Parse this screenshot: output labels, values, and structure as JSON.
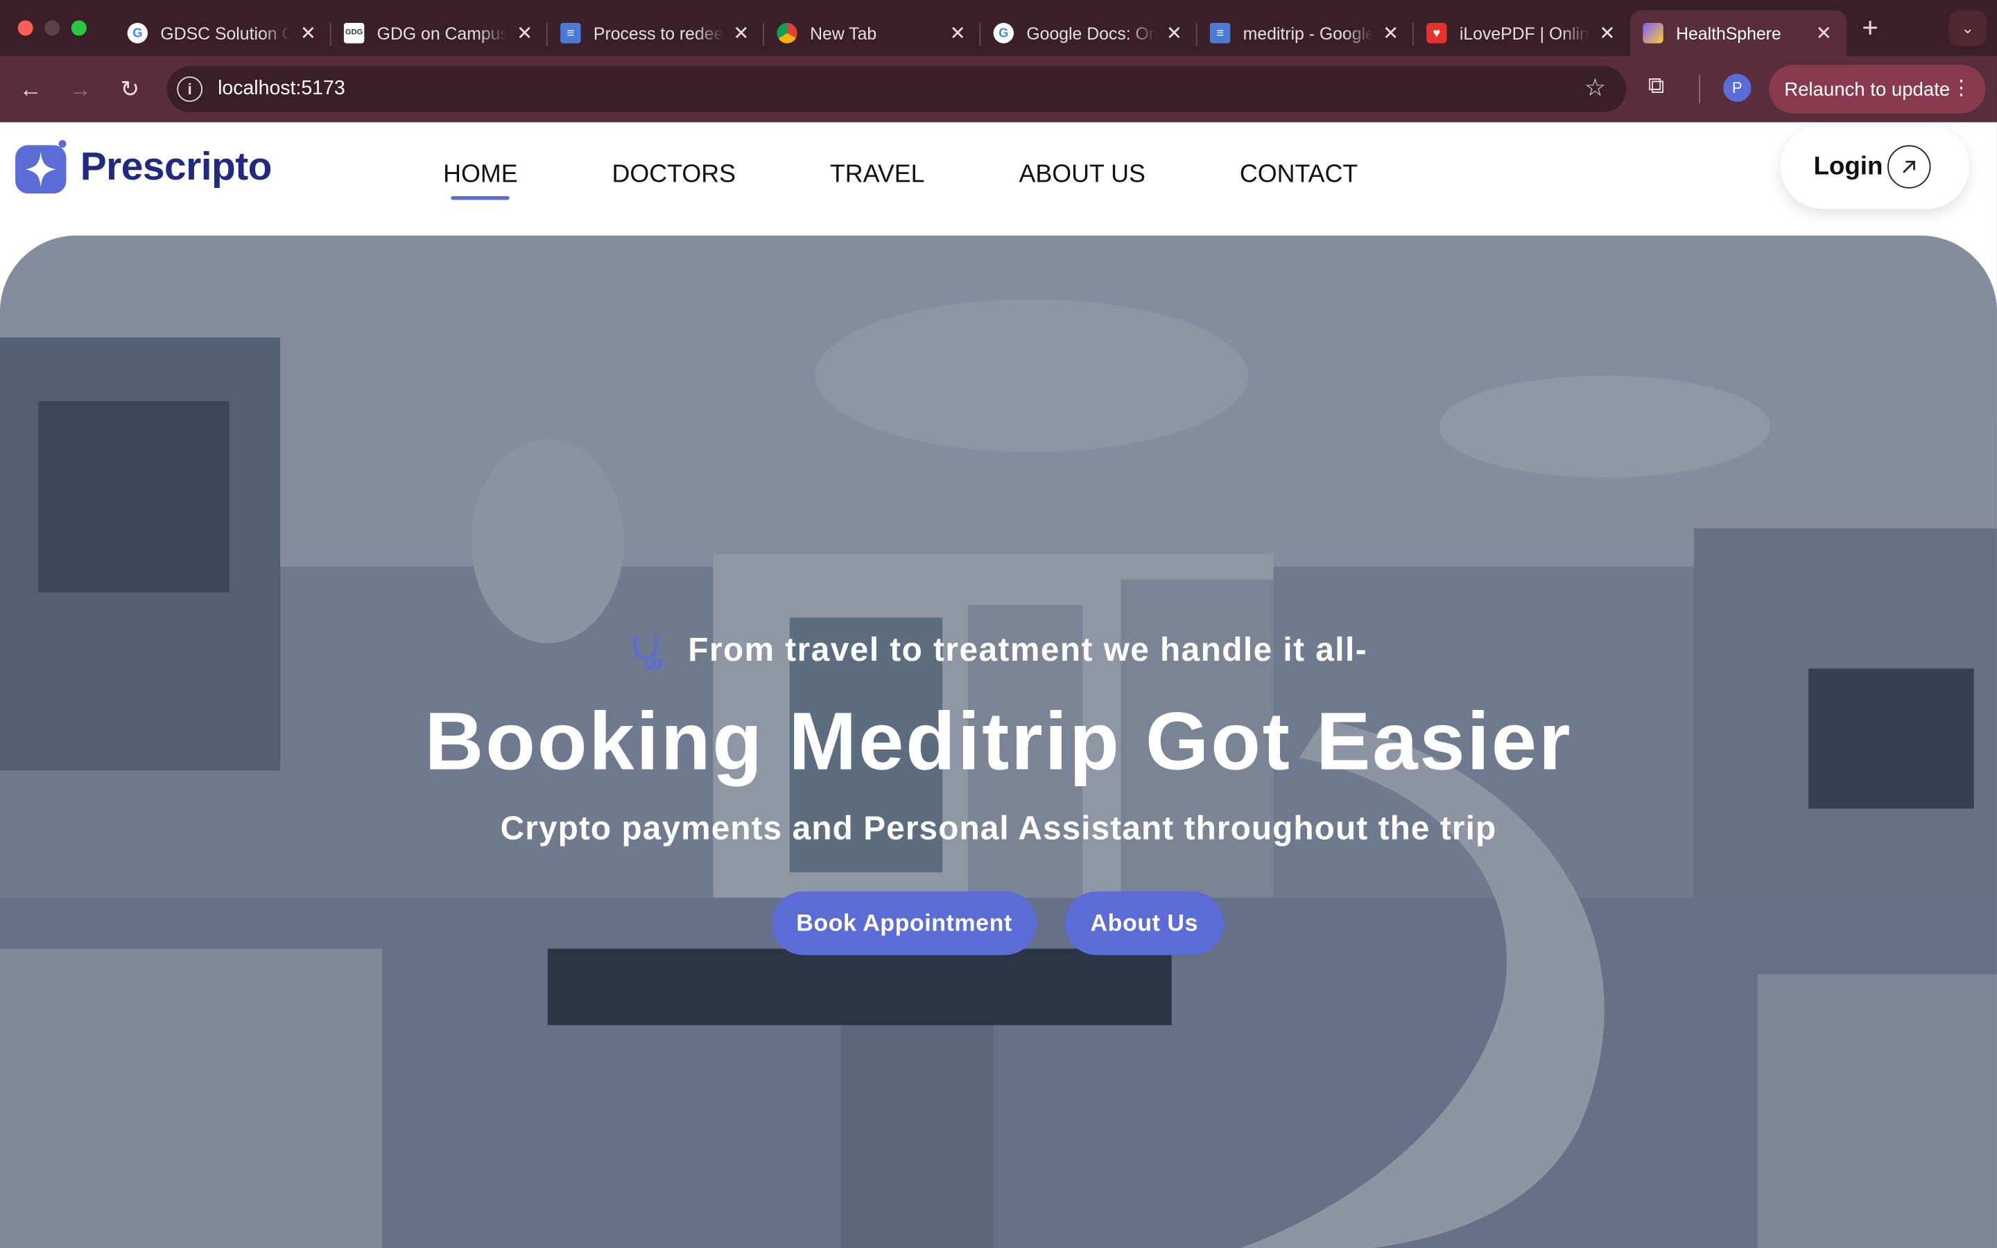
{
  "browser": {
    "tabs": [
      {
        "title": "GDSC Solution Challenge",
        "icon": "google-icon"
      },
      {
        "title": "GDG on Campus",
        "icon": "gdg-icon"
      },
      {
        "title": "Process to redeem",
        "icon": "docs-icon"
      },
      {
        "title": "New Tab",
        "icon": "chrome-icon"
      },
      {
        "title": "Google Docs: Online",
        "icon": "google-icon"
      },
      {
        "title": "meditrip - Google Docs",
        "icon": "docs-icon"
      },
      {
        "title": "iLovePDF | Online",
        "icon": "ilovepdf-icon"
      },
      {
        "title": "HealthSphere",
        "icon": "healthsphere-icon"
      }
    ],
    "url": "localhost:5173",
    "profile_initial": "P",
    "relaunch_label": "Relaunch to update"
  },
  "site": {
    "brand": "Prescripto",
    "nav": [
      "HOME",
      "DOCTORS",
      "TRAVEL",
      "ABOUT US",
      "CONTACT"
    ],
    "active_nav": "HOME",
    "login_label": "Login"
  },
  "hero": {
    "tagline": "From travel to treatment we handle it all-",
    "title": "Booking Meditrip Got Easier",
    "subtitle": "Crypto payments and Personal Assistant throughout the trip",
    "primary_button": "Book Appointment",
    "secondary_button": "About Us"
  },
  "colors": {
    "accent": "#5b6cd6",
    "brand_text": "#1f2a80",
    "browser_frame": "#5a2d3c"
  }
}
